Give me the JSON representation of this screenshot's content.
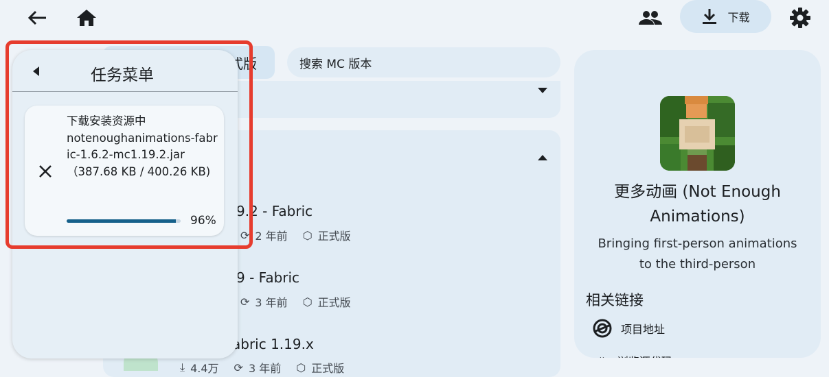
{
  "colors": {
    "accent": "#15608a",
    "highlight": "#e63c2e",
    "pill": "#d6e6f3"
  },
  "topbar": {
    "back_icon": "arrow-left-icon",
    "home_icon": "home-icon",
    "accounts_icon": "people-icon",
    "download_label": "下载",
    "settings_icon": "gear-icon"
  },
  "filter": {
    "tab_label": "式版",
    "search_placeholder": "搜索 MC 版本"
  },
  "versions": [
    {
      "title": "9.2 - Fabric",
      "updated": "2 年前",
      "type": "正式版"
    },
    {
      "title": "9 - Fabric",
      "updated": "3 年前",
      "type": "正式版"
    },
    {
      "title": "abric 1.19.x",
      "downloads": "4.4万",
      "updated": "3 年前",
      "type": "正式版"
    }
  ],
  "detail": {
    "mod_name": "更多动画 (Not Enough Animations)",
    "mod_name_line1": "更多动画 (Not Enough",
    "mod_name_line2": "Animations)",
    "description_line1": "Bringing first-person animations",
    "description_line2": "to the third-person",
    "links_heading": "相关链接",
    "links": [
      {
        "label": "项目地址"
      },
      {
        "label": "浏览源代码"
      }
    ]
  },
  "task_menu": {
    "title": "任务菜单",
    "task": {
      "status": "下载安装资源中",
      "filename": "notenoughanimations-fabric-1.6.2-mc1.19.2.jar",
      "size": "（387.68 KB / 400.26 KB)",
      "progress_fraction": 0.96,
      "progress_label": "96%"
    }
  }
}
